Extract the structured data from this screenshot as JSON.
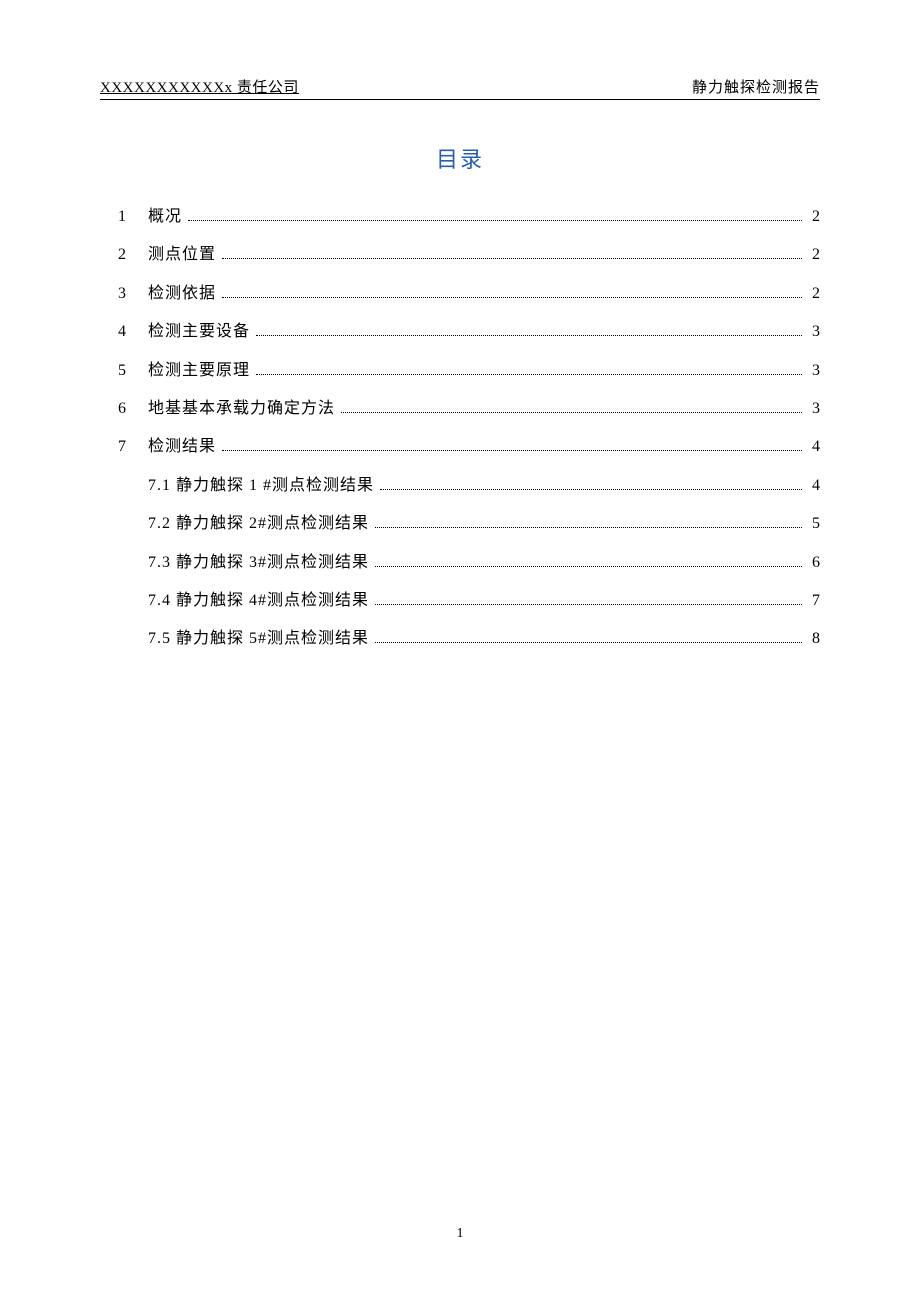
{
  "header": {
    "left": "XXXXXXXXXXXx 责任公司",
    "right": "静力触探检测报告"
  },
  "title": "目录",
  "toc": [
    {
      "num": "1",
      "label": "概况",
      "page": "2"
    },
    {
      "num": "2",
      "label": "测点位置",
      "page": "2"
    },
    {
      "num": "3",
      "label": "检测依据",
      "page": "2"
    },
    {
      "num": "4",
      "label": "检测主要设备",
      "page": "3"
    },
    {
      "num": "5",
      "label": "检测主要原理",
      "page": "3"
    },
    {
      "num": "6",
      "label": "地基基本承载力确定方法",
      "page": "3"
    },
    {
      "num": "7",
      "label": "检测结果",
      "page": "4"
    }
  ],
  "toc_sub": [
    {
      "label": "7.1 静力触探 1 #测点检测结果",
      "page": "4"
    },
    {
      "label": "7.2 静力触探 2#测点检测结果",
      "page": "5"
    },
    {
      "label": "7.3 静力触探 3#测点检测结果",
      "page": "6"
    },
    {
      "label": "7.4 静力触探 4#测点检测结果",
      "page": "7"
    },
    {
      "label": "7.5 静力触探 5#测点检测结果",
      "page": "8"
    }
  ],
  "page_number": "1"
}
